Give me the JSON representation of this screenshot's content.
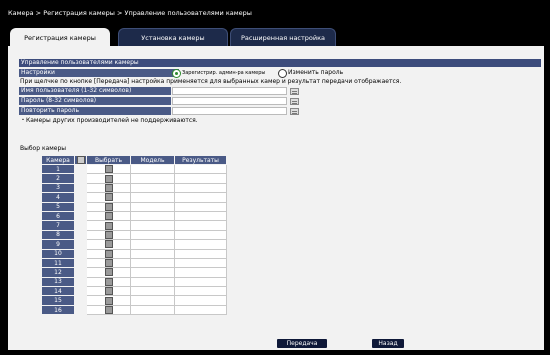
{
  "breadcrumb": "Камера > Регистрация камеры > Управление пользователями камеры",
  "tabs": [
    {
      "label": "Регистрация камеры"
    },
    {
      "label": "Установка камеры"
    },
    {
      "label": "Расширенная настройка"
    }
  ],
  "section_title": "Управление пользователями камеры",
  "settings": {
    "label": "Настройки",
    "option1": "Зарегистрир. админ-ра камеры",
    "option2": "Изменить пароль"
  },
  "notice": "При щелчке по кнопке [Передача] настройка применяется для выбранных камер и результат передачи отображается.",
  "fields": {
    "username_label": "Имя пользователя (1-32 символов)",
    "password_label": "Пароль (8-32 символов)",
    "repeat_label": "Повторить пароль"
  },
  "note": "・Камеры других производителей не поддерживаются.",
  "camera_select": {
    "title": "Выбор камеры",
    "headers": [
      "Камера",
      "Выбрать",
      "Модель",
      "Результаты"
    ],
    "rows": [
      "1",
      "2",
      "3",
      "4",
      "5",
      "6",
      "7",
      "8",
      "9",
      "10",
      "11",
      "12",
      "13",
      "14",
      "15",
      "16"
    ]
  },
  "buttons": {
    "send": "Передача",
    "back": "Назад"
  }
}
